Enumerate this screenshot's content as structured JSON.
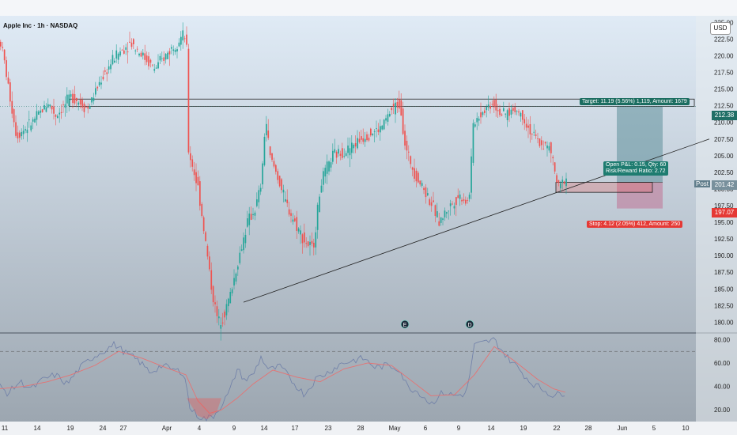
{
  "header": {
    "symbol_title": "Apple Inc · 1h · NASDAQ",
    "currency": "USD"
  },
  "price_badges": {
    "current": "212.38",
    "post_label": "Post",
    "post": "201.42",
    "stop": "197.07"
  },
  "annotations": {
    "target": "Target: 11.19 (5.56%) 1,119, Amount: 1679",
    "open_pl": "Open P&L: 0.15, Qty: 60",
    "risk_reward": "Risk/Reward Ratio: 2.72",
    "stop": "Stop: 4.12 (2.05%) 412, Amount: 250"
  },
  "event_markers": [
    "E",
    "D"
  ],
  "colors": {
    "up": "#26a69a",
    "down": "#ef5350",
    "rsi": "#6f7fa8",
    "rsi_ma": "#e57373",
    "target_zone": "#5f8f9b",
    "stop_zone": "#c07a9a"
  },
  "chart_data": [
    {
      "type": "candlestick",
      "y_axis_side": "right",
      "ylim": [
        178.5,
        226
      ],
      "y_ticks": [
        180.0,
        182.5,
        185.0,
        187.5,
        190.0,
        192.5,
        195.0,
        197.5,
        200.0,
        202.5,
        205.0,
        207.5,
        210.0,
        212.5,
        215.0,
        217.5,
        220.0,
        222.5,
        225.0
      ],
      "x_ticks": [
        "11",
        "14",
        "19",
        "24",
        "27",
        "Apr",
        "4",
        "9",
        "14",
        "17",
        "23",
        "28",
        "May",
        "6",
        "9",
        "14",
        "19",
        "22",
        "28",
        "Jun",
        "5",
        "10"
      ],
      "price_path": [
        {
          "t": 0,
          "p": 222
        },
        {
          "t": 5,
          "p": 219
        },
        {
          "t": 10,
          "p": 215
        },
        {
          "t": 20,
          "p": 208
        },
        {
          "t": 40,
          "p": 210
        },
        {
          "t": 60,
          "p": 213
        },
        {
          "t": 70,
          "p": 211
        },
        {
          "t": 90,
          "p": 214
        },
        {
          "t": 110,
          "p": 212
        },
        {
          "t": 125,
          "p": 216
        },
        {
          "t": 145,
          "p": 220
        },
        {
          "t": 165,
          "p": 222
        },
        {
          "t": 180,
          "p": 220
        },
        {
          "t": 195,
          "p": 218
        },
        {
          "t": 215,
          "p": 221
        },
        {
          "t": 230,
          "p": 223
        },
        {
          "t": 235,
          "p": 222.5
        },
        {
          "t": 237,
          "p": 206
        },
        {
          "t": 250,
          "p": 200
        },
        {
          "t": 258,
          "p": 193
        },
        {
          "t": 268,
          "p": 184
        },
        {
          "t": 275,
          "p": 180
        },
        {
          "t": 282,
          "p": 181
        },
        {
          "t": 290,
          "p": 184
        },
        {
          "t": 300,
          "p": 189
        },
        {
          "t": 312,
          "p": 195
        },
        {
          "t": 322,
          "p": 197
        },
        {
          "t": 330,
          "p": 201
        },
        {
          "t": 335,
          "p": 211
        },
        {
          "t": 340,
          "p": 205
        },
        {
          "t": 350,
          "p": 202
        },
        {
          "t": 360,
          "p": 198
        },
        {
          "t": 372,
          "p": 195
        },
        {
          "t": 385,
          "p": 192
        },
        {
          "t": 395,
          "p": 191
        },
        {
          "t": 405,
          "p": 201
        },
        {
          "t": 420,
          "p": 205
        },
        {
          "t": 440,
          "p": 206
        },
        {
          "t": 460,
          "p": 208
        },
        {
          "t": 480,
          "p": 209
        },
        {
          "t": 495,
          "p": 212
        },
        {
          "t": 505,
          "p": 213
        },
        {
          "t": 512,
          "p": 206
        },
        {
          "t": 525,
          "p": 202
        },
        {
          "t": 540,
          "p": 199
        },
        {
          "t": 555,
          "p": 195
        },
        {
          "t": 565,
          "p": 197
        },
        {
          "t": 580,
          "p": 199
        },
        {
          "t": 592,
          "p": 198
        },
        {
          "t": 598,
          "p": 210
        },
        {
          "t": 612,
          "p": 212
        },
        {
          "t": 622,
          "p": 213
        },
        {
          "t": 635,
          "p": 211
        },
        {
          "t": 650,
          "p": 212
        },
        {
          "t": 660,
          "p": 211
        },
        {
          "t": 668,
          "p": 209
        },
        {
          "t": 680,
          "p": 207
        },
        {
          "t": 695,
          "p": 206
        },
        {
          "t": 705,
          "p": 200
        },
        {
          "t": 716,
          "p": 202
        }
      ],
      "resistance_box": [
        213.5,
        212.4
      ],
      "trendline": [
        {
          "t": 308,
          "p": 183
        },
        {
          "t": 897,
          "p": 207.5
        }
      ],
      "position": {
        "entry": 201.0,
        "target": 212.38,
        "stop": 197.07,
        "open_box": [
          201.0,
          199.5
        ]
      },
      "annotation_placement": {
        "target": "above-right",
        "stop": "below-right"
      }
    },
    {
      "type": "line",
      "y_axis_side": "right",
      "ylim": [
        10,
        85
      ],
      "y_ticks": [
        20.0,
        40.0,
        60.0,
        80.0
      ],
      "overbought_level": 70,
      "series": [
        {
          "role": "rsi",
          "points": [
            {
              "t": 0,
              "v": 40
            },
            {
              "t": 10,
              "v": 34
            },
            {
              "t": 25,
              "v": 44
            },
            {
              "t": 40,
              "v": 38
            },
            {
              "t": 55,
              "v": 46
            },
            {
              "t": 70,
              "v": 50
            },
            {
              "t": 85,
              "v": 42
            },
            {
              "t": 100,
              "v": 55
            },
            {
              "t": 115,
              "v": 64
            },
            {
              "t": 130,
              "v": 70
            },
            {
              "t": 145,
              "v": 76
            },
            {
              "t": 160,
              "v": 68
            },
            {
              "t": 175,
              "v": 62
            },
            {
              "t": 190,
              "v": 52
            },
            {
              "t": 205,
              "v": 58
            },
            {
              "t": 220,
              "v": 54
            },
            {
              "t": 233,
              "v": 52
            },
            {
              "t": 240,
              "v": 22
            },
            {
              "t": 250,
              "v": 15
            },
            {
              "t": 260,
              "v": 12
            },
            {
              "t": 270,
              "v": 15
            },
            {
              "t": 280,
              "v": 24
            },
            {
              "t": 290,
              "v": 35
            },
            {
              "t": 300,
              "v": 55
            },
            {
              "t": 310,
              "v": 45
            },
            {
              "t": 320,
              "v": 50
            },
            {
              "t": 330,
              "v": 65
            },
            {
              "t": 340,
              "v": 54
            },
            {
              "t": 355,
              "v": 57
            },
            {
              "t": 370,
              "v": 44
            },
            {
              "t": 385,
              "v": 33
            },
            {
              "t": 400,
              "v": 47
            },
            {
              "t": 415,
              "v": 52
            },
            {
              "t": 430,
              "v": 59
            },
            {
              "t": 445,
              "v": 62
            },
            {
              "t": 460,
              "v": 64
            },
            {
              "t": 475,
              "v": 56
            },
            {
              "t": 490,
              "v": 58
            },
            {
              "t": 505,
              "v": 55
            },
            {
              "t": 515,
              "v": 40
            },
            {
              "t": 530,
              "v": 35
            },
            {
              "t": 545,
              "v": 25
            },
            {
              "t": 560,
              "v": 35
            },
            {
              "t": 575,
              "v": 32
            },
            {
              "t": 590,
              "v": 34
            },
            {
              "t": 600,
              "v": 75
            },
            {
              "t": 615,
              "v": 78
            },
            {
              "t": 625,
              "v": 80
            },
            {
              "t": 640,
              "v": 66
            },
            {
              "t": 655,
              "v": 56
            },
            {
              "t": 670,
              "v": 44
            },
            {
              "t": 685,
              "v": 38
            },
            {
              "t": 700,
              "v": 32
            },
            {
              "t": 715,
              "v": 35
            }
          ]
        },
        {
          "role": "rsi_ma",
          "points": [
            {
              "t": 0,
              "v": 38
            },
            {
              "t": 30,
              "v": 40
            },
            {
              "t": 60,
              "v": 44
            },
            {
              "t": 90,
              "v": 50
            },
            {
              "t": 120,
              "v": 58
            },
            {
              "t": 150,
              "v": 70
            },
            {
              "t": 180,
              "v": 64
            },
            {
              "t": 210,
              "v": 56
            },
            {
              "t": 235,
              "v": 50
            },
            {
              "t": 250,
              "v": 28
            },
            {
              "t": 265,
              "v": 17
            },
            {
              "t": 280,
              "v": 20
            },
            {
              "t": 300,
              "v": 30
            },
            {
              "t": 320,
              "v": 42
            },
            {
              "t": 345,
              "v": 54
            },
            {
              "t": 375,
              "v": 48
            },
            {
              "t": 405,
              "v": 44
            },
            {
              "t": 435,
              "v": 55
            },
            {
              "t": 465,
              "v": 60
            },
            {
              "t": 495,
              "v": 58
            },
            {
              "t": 520,
              "v": 45
            },
            {
              "t": 545,
              "v": 32
            },
            {
              "t": 575,
              "v": 33
            },
            {
              "t": 600,
              "v": 50
            },
            {
              "t": 625,
              "v": 74
            },
            {
              "t": 650,
              "v": 62
            },
            {
              "t": 680,
              "v": 46
            },
            {
              "t": 700,
              "v": 38
            },
            {
              "t": 715,
              "v": 35
            }
          ]
        }
      ]
    }
  ]
}
